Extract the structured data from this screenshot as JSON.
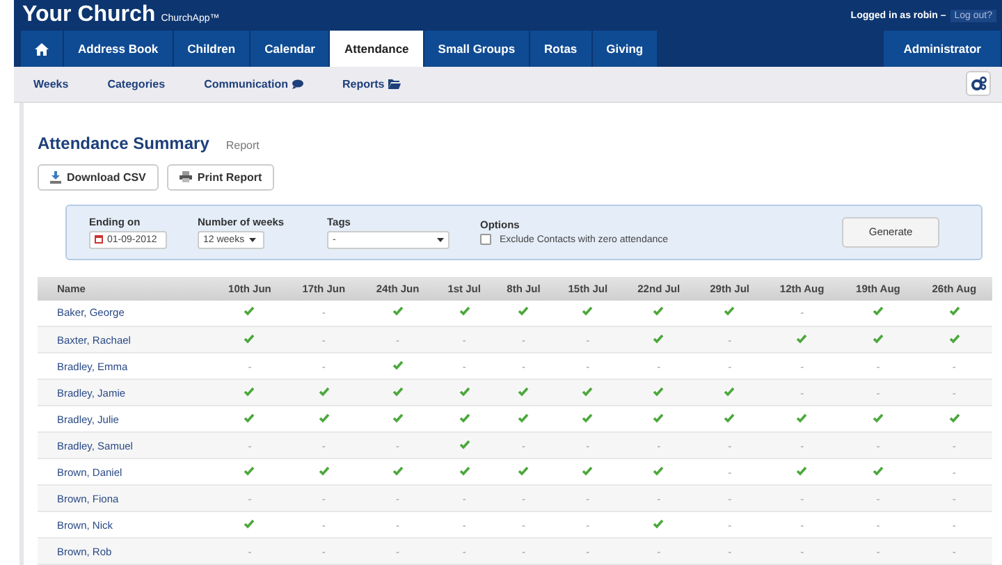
{
  "header": {
    "title": "Your Church",
    "app_name": "ChurchApp™",
    "login_text": "Logged in as robin –",
    "logout": "Log out?"
  },
  "tabs": [
    {
      "kind": "home",
      "selected": false
    },
    {
      "label": "Address Book",
      "selected": false
    },
    {
      "label": "Children",
      "selected": false
    },
    {
      "label": "Calendar",
      "selected": false
    },
    {
      "label": "Attendance",
      "selected": true
    },
    {
      "label": "Small Groups",
      "selected": false
    },
    {
      "label": "Rotas",
      "selected": false
    },
    {
      "label": "Giving",
      "selected": false
    }
  ],
  "admin_tab": "Administrator",
  "subnav": [
    {
      "label": "Weeks"
    },
    {
      "label": "Categories"
    },
    {
      "label": "Communication"
    },
    {
      "label": "Reports"
    }
  ],
  "page": {
    "title": "Attendance Summary",
    "subtitle": "Report"
  },
  "actions": [
    {
      "label": "Download CSV"
    },
    {
      "label": "Print Report"
    }
  ],
  "filters": {
    "ending_label": "Ending on",
    "ending_value": "01-09-2012",
    "weeks_label": "Number of weeks",
    "weeks_value": "12 weeks",
    "tags_label": "Tags",
    "tags_value": "-",
    "options_label": "Options",
    "exclude_label": "Exclude Contacts with zero attendance",
    "exclude_checked": false,
    "generate": "Generate"
  },
  "table": {
    "columns": [
      "Name",
      "10th Jun",
      "17th Jun",
      "24th Jun",
      "1st Jul",
      "8th Jul",
      "15th Jul",
      "22nd Jul",
      "29th Jul",
      "12th Aug",
      "19th Aug",
      "26th Aug"
    ],
    "absent": "-",
    "rows": [
      {
        "name": "Baker, George",
        "attended": [
          true,
          false,
          true,
          true,
          true,
          true,
          true,
          true,
          false,
          true,
          true
        ]
      },
      {
        "name": "Baxter, Rachael",
        "attended": [
          true,
          false,
          false,
          false,
          false,
          false,
          true,
          false,
          true,
          true,
          true
        ]
      },
      {
        "name": "Bradley, Emma",
        "attended": [
          false,
          false,
          true,
          false,
          false,
          false,
          false,
          false,
          false,
          false,
          false
        ]
      },
      {
        "name": "Bradley, Jamie",
        "attended": [
          true,
          true,
          true,
          true,
          true,
          true,
          true,
          true,
          false,
          false,
          false
        ]
      },
      {
        "name": "Bradley, Julie",
        "attended": [
          true,
          true,
          true,
          true,
          true,
          true,
          true,
          true,
          true,
          true,
          true
        ]
      },
      {
        "name": "Bradley, Samuel",
        "attended": [
          false,
          false,
          false,
          true,
          false,
          false,
          false,
          false,
          false,
          false,
          false
        ]
      },
      {
        "name": "Brown, Daniel",
        "attended": [
          true,
          true,
          true,
          true,
          true,
          true,
          true,
          false,
          true,
          true,
          false
        ]
      },
      {
        "name": "Brown, Fiona",
        "attended": [
          false,
          false,
          false,
          false,
          false,
          false,
          false,
          false,
          false,
          false,
          false
        ]
      },
      {
        "name": "Brown, Nick",
        "attended": [
          true,
          false,
          false,
          false,
          false,
          false,
          true,
          false,
          false,
          false,
          false
        ]
      },
      {
        "name": "Brown, Rob",
        "attended": [
          false,
          false,
          false,
          false,
          false,
          false,
          false,
          false,
          false,
          false,
          false
        ]
      }
    ]
  }
}
